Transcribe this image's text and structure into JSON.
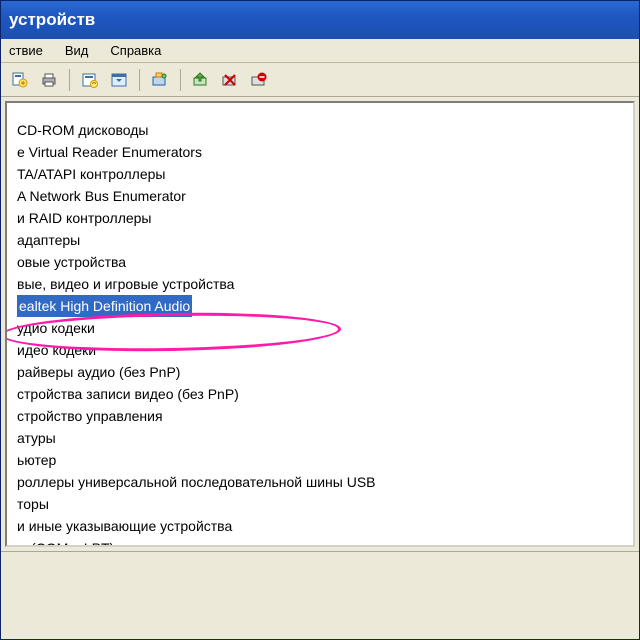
{
  "window": {
    "title": " устройств"
  },
  "menu": {
    "action": "ствие",
    "view": "Вид",
    "help": "Справка"
  },
  "toolbar": {
    "icons": [
      "properties",
      "print",
      "refresh",
      "details-pane",
      "image",
      "network",
      "disable",
      "uninstall"
    ]
  },
  "tree": {
    "items": [
      " CD-ROM дисководы",
      "e Virtual Reader Enumerators",
      "TA/ATAPI контроллеры",
      "A Network Bus Enumerator",
      "и RAID контроллеры",
      "адаптеры",
      "овые устройства",
      "вые, видео и игровые устройства",
      "ealtek High Definition Audio",
      "удио кодеки",
      "идео кодеки",
      "райверы аудио (без PnP)",
      "стройства записи видео (без PnP)",
      "стройство управления",
      "атуры",
      "ьютер",
      "роллеры универсальной последовательной шины USB",
      "торы",
      " и иные указывающие устройства",
      "ы (COM и LPT)"
    ],
    "selected_index": 8
  }
}
